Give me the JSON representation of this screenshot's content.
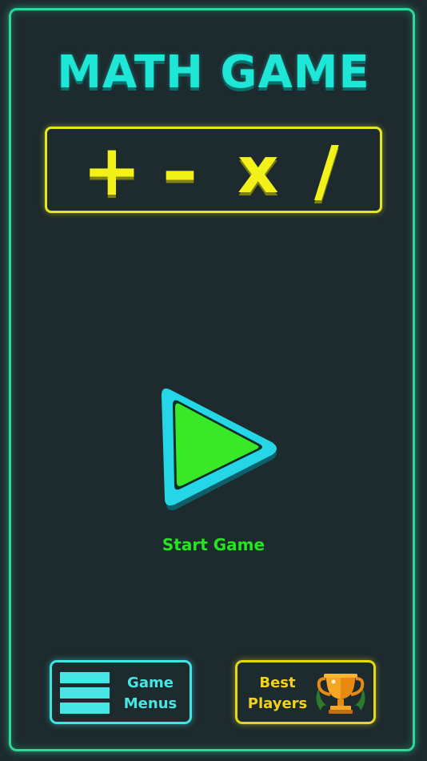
{
  "title": "MATH GAME",
  "operators": [
    "+",
    "–",
    "x",
    "/"
  ],
  "start": {
    "label": "Start Game"
  },
  "menu_button": {
    "line1": "Game",
    "line2": "Menus"
  },
  "best_button": {
    "line1": "Best",
    "line2": "Players"
  },
  "colors": {
    "background": "#1d2a2e",
    "frame": "#2fd89a",
    "title": "#1fe7d8",
    "operators": "#f2f21a",
    "play_fill": "#39e827",
    "play_border": "#25d7e6",
    "start_label": "#26e41f",
    "menu_accent": "#45e6e4",
    "best_accent": "#f2d21a"
  },
  "icons": {
    "play": "play-triangle-icon",
    "menu": "hamburger-menu-icon",
    "trophy": "trophy-icon"
  }
}
